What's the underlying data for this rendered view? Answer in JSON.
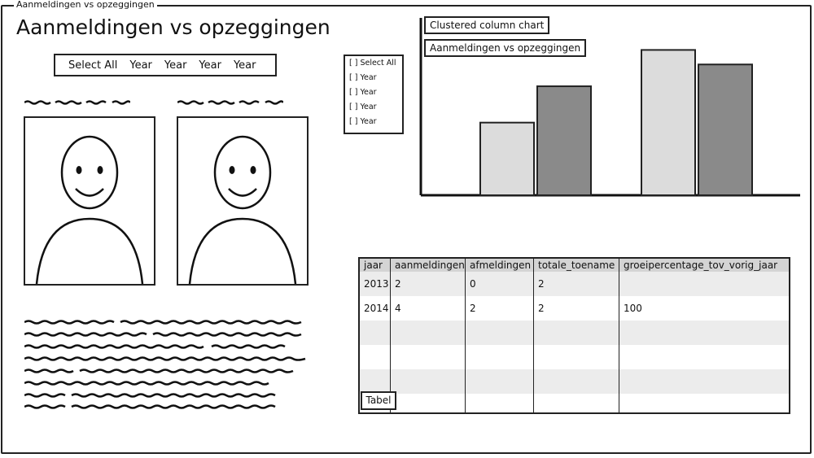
{
  "window": {
    "title": "Aanmeldingen vs opzeggingen"
  },
  "page": {
    "heading": "Aanmeldingen vs opzeggingen"
  },
  "year_tabs": [
    "Select All",
    "Year",
    "Year",
    "Year",
    "Year"
  ],
  "checkbox_list": [
    "[ ] Select All",
    "[ ] Year",
    "[ ] Year",
    "[ ] Year",
    "[ ] Year"
  ],
  "chart_panel": {
    "type_label": "Clustered column chart",
    "title_label": "Aanmeldingen vs opzeggingen"
  },
  "colors": {
    "light_bar": "#dcdcdc",
    "dark_bar": "#8a8a8a",
    "header_row": "#d4d4d4",
    "stripe_row": "#ececec"
  },
  "chart_data": {
    "type": "bar",
    "categories": [
      "",
      ""
    ],
    "series": [
      {
        "values": [
          2,
          4
        ]
      },
      {
        "values": [
          3,
          3.6
        ]
      }
    ],
    "title": "Aanmeldingen vs opzeggingen",
    "xlabel": "",
    "ylabel": "",
    "ylim": [
      0,
      4.3
    ],
    "grid": false
  },
  "table": {
    "columns": [
      "jaar",
      "aanmeldingen",
      "afmeldingen",
      "totale_toename",
      "groeipercentage_tov_vorig_jaar"
    ],
    "rows": [
      [
        "2013",
        "2",
        "0",
        "2",
        ""
      ],
      [
        "2014",
        "4",
        "2",
        "2",
        "100"
      ]
    ],
    "empty_rows": 3
  },
  "tabel_button": "Tabel",
  "icons": [
    "smiley-avatar-icon",
    "smiley-avatar-icon"
  ]
}
